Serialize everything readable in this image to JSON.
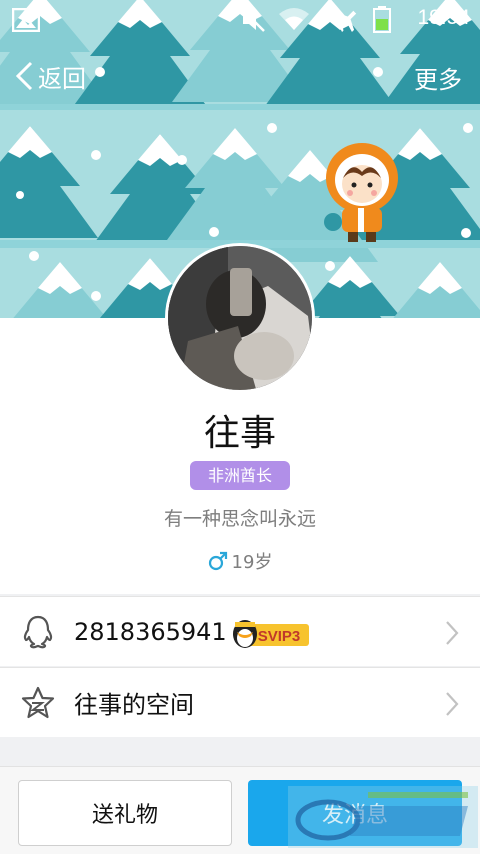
{
  "status_bar": {
    "time": "19:54",
    "icons": [
      "image-notification-icon",
      "mute-icon",
      "wifi-icon",
      "airplane-mode-icon",
      "battery-icon"
    ]
  },
  "navbar": {
    "back_label": "返回",
    "more_label": "更多"
  },
  "profile": {
    "name": "往事",
    "badge": "非洲酋长",
    "signature": "有一种思念叫永远",
    "gender_icon": "male-icon",
    "age": "19岁"
  },
  "rows": {
    "qq_number": "2818365941",
    "svip_label": "SVIP3",
    "space_label": "往事的空间"
  },
  "bottom": {
    "gift_label": "送礼物",
    "message_label": "发消息"
  },
  "colors": {
    "header_bg": "#a9dde0",
    "tree_dark": "#2f97a4",
    "tree_light": "#78c7cf",
    "badge": "#b18fe8",
    "primary": "#1aa7ec",
    "male": "#2aa7d9"
  }
}
